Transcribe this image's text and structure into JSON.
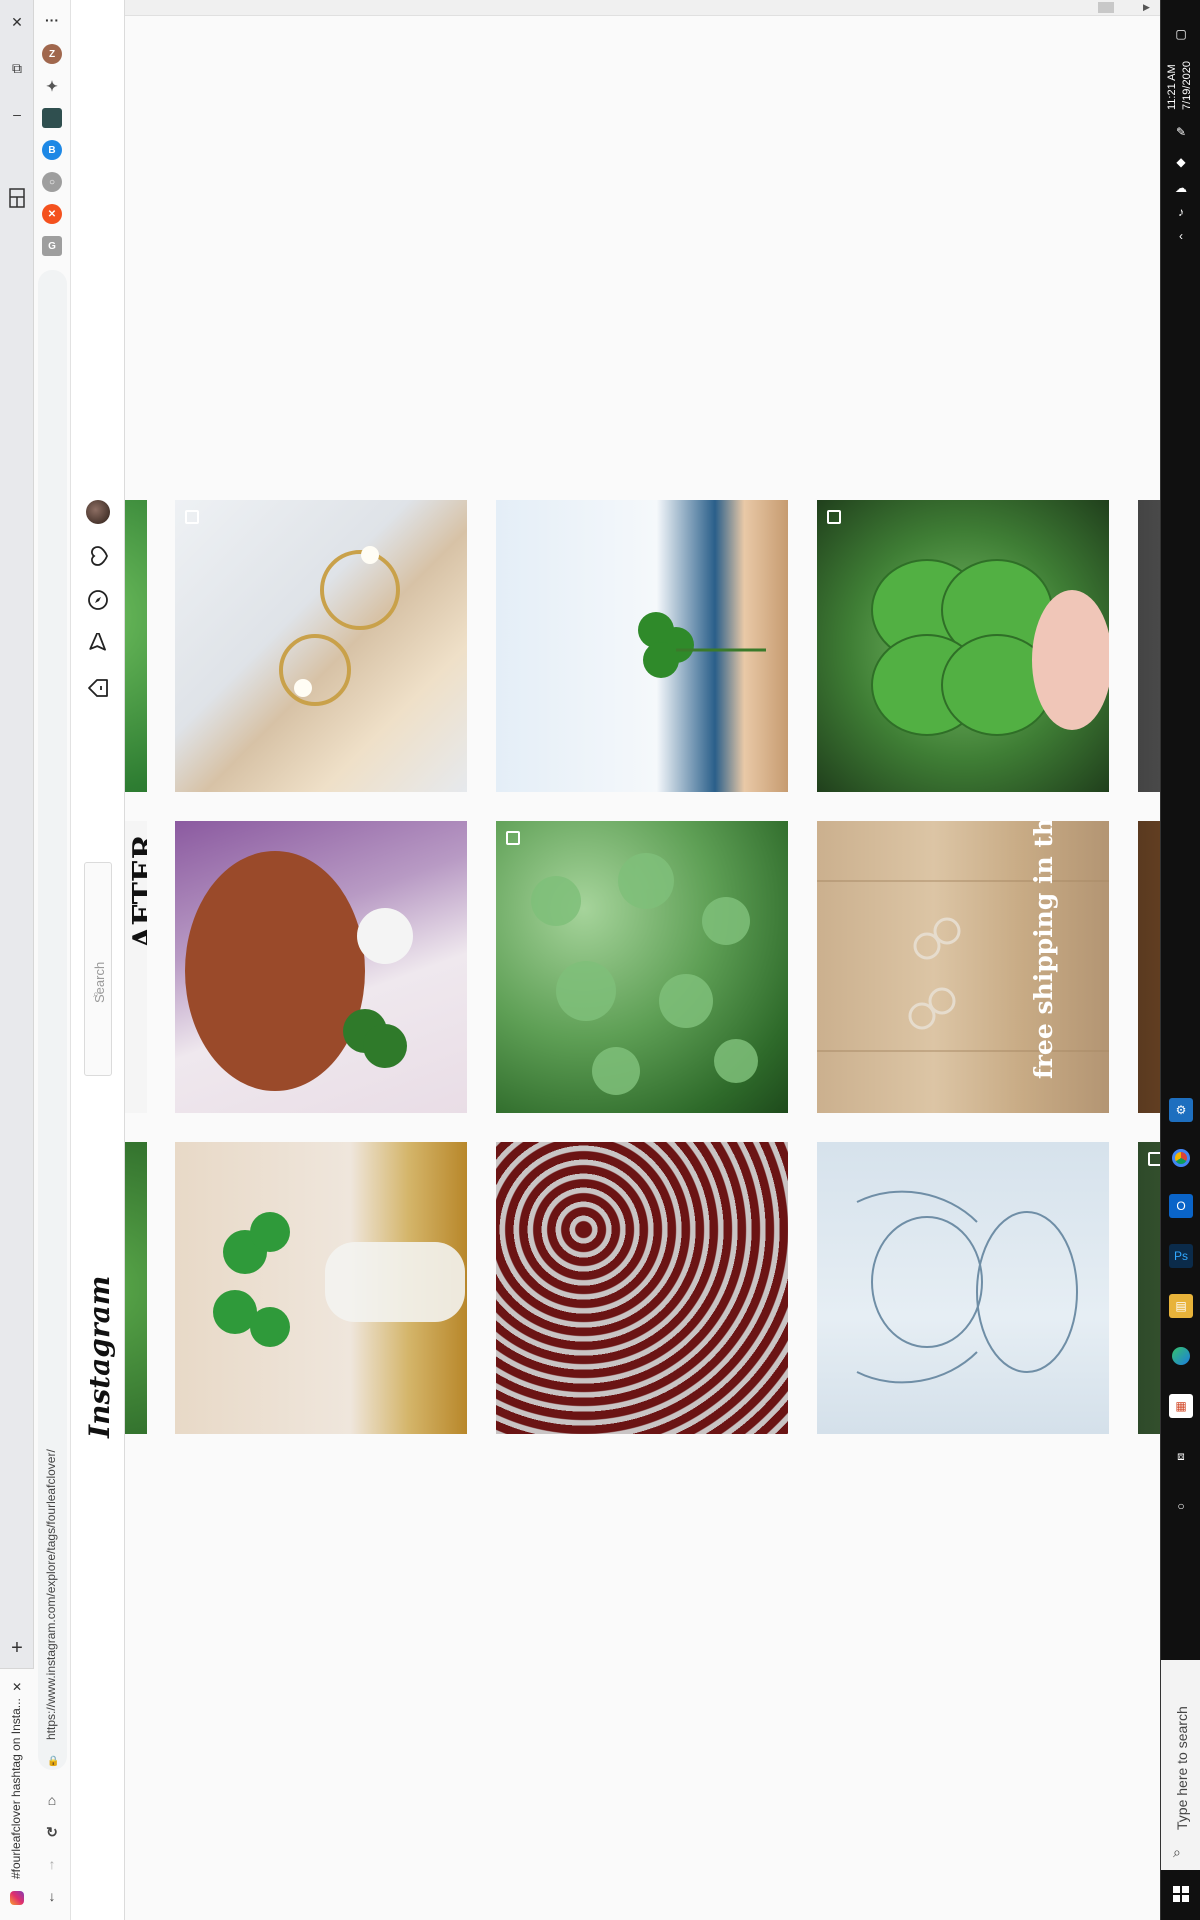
{
  "browser": {
    "tab_title": "#fourleafclover hashtag on Insta...",
    "url": "https://www.instagram.com/explore/tags/fourleafclover/",
    "menu_glyph": "···",
    "new_tab_glyph": "+",
    "close_glyph": "✕",
    "profile_initial": "Z"
  },
  "instagram": {
    "logo": "Instagram",
    "search_placeholder": "Search"
  },
  "posts": [
    {
      "row": 1,
      "col": 1,
      "alt": "gold pearl earrings on book page",
      "multi": true
    },
    {
      "row": 1,
      "col": 2,
      "alt": "hand holding clover near screen",
      "multi": false
    },
    {
      "row": 1,
      "col": 3,
      "alt": "four leaf clover in hand",
      "multi": true
    },
    {
      "row": 2,
      "col": 1,
      "alt": "dog with dandelion and clover",
      "multi": false
    },
    {
      "row": 2,
      "col": 2,
      "alt": "field of clovers",
      "multi": true
    },
    {
      "row": 2,
      "col": 3,
      "alt": "clover earrings on wood",
      "multi": false,
      "caption": "free shipping in the U.S.A."
    },
    {
      "row": 3,
      "col": 1,
      "alt": "green crystal clover vase",
      "multi": false
    },
    {
      "row": 3,
      "col": 2,
      "alt": "red clover pattern",
      "multi": false
    },
    {
      "row": 3,
      "col": 3,
      "alt": "pencil drawing of fairy",
      "multi": false
    }
  ],
  "partial_left": {
    "row2_text": "AFTER"
  },
  "system": {
    "time": "11:21 AM",
    "date": "7/19/2020",
    "search_placeholder": "Type here to search"
  },
  "colors": {
    "ig_border": "#dbdbdb",
    "taskbar": "#101010"
  }
}
